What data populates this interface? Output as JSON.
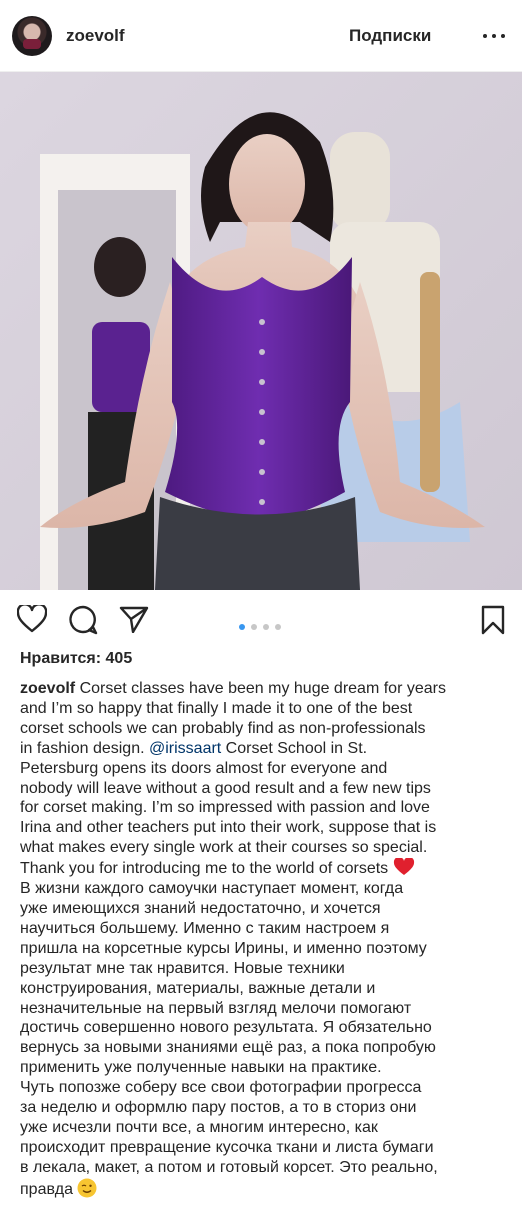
{
  "header": {
    "username": "zoevolf",
    "follow_label": "Подписки",
    "more_icon": "more-horizontal-icon"
  },
  "post": {
    "carousel": {
      "count": 4,
      "active_index": 0
    },
    "likes_text": "Нравится: 405",
    "caption": {
      "username": "zoevolf",
      "first_line_text": " Corset classes have been my huge dream for years",
      "lines": [
        "and I’m so happy that finally I made it to one of the best",
        "corset schools we can probably find as non-professionals",
        "in fashion design. ",
        "Petersburg opens its doors almost for everyone and",
        "nobody will leave without a good result and a few new tips",
        "for corset making. I’m so impressed with passion and love",
        "Irina and other teachers put into their work, suppose that is",
        "what makes every single work at their courses so special.",
        "Thank you for introducing me to the world of corsets ",
        "В жизни каждого самоучки наступает момент, когда",
        "уже имеющихся знаний недостаточно, и хочется",
        "научиться большему. Именно с таким настроем я",
        "пришла на корсетные курсы Ирины, и именно поэтому",
        "результат мне так нравится. Новые техники",
        "конструирования, материалы, важные детали и",
        "незначительные на первый взгляд мелочи помогают",
        "достичь совершенно нового результата. Я обязательно",
        "вернусь за новыми знаниями ещё раз, а пока попробую",
        "применить уже полученные навыки на практике.",
        "Чуть попозже соберу все свои фотографии прогресса",
        "за неделю и оформлю пару постов, а то в сториз они",
        "уже исчезли почти все, а многим интересно, как",
        "происходит превращение кусочка ткани и листа бумаги",
        "в лекала, макет, а потом и готовый корсет. Это реально,",
        "правда "
      ],
      "mention": "@irissaart",
      "mention_after": " Corset School in St.",
      "heart_emoji": "heart-emoji",
      "wink_emoji": "wink-emoji"
    }
  },
  "colors": {
    "text": "#262626",
    "mention": "#003569",
    "active_dot": "#3897f0",
    "inactive_dot": "#c7c7c7",
    "corset": "#6a2aa3"
  }
}
